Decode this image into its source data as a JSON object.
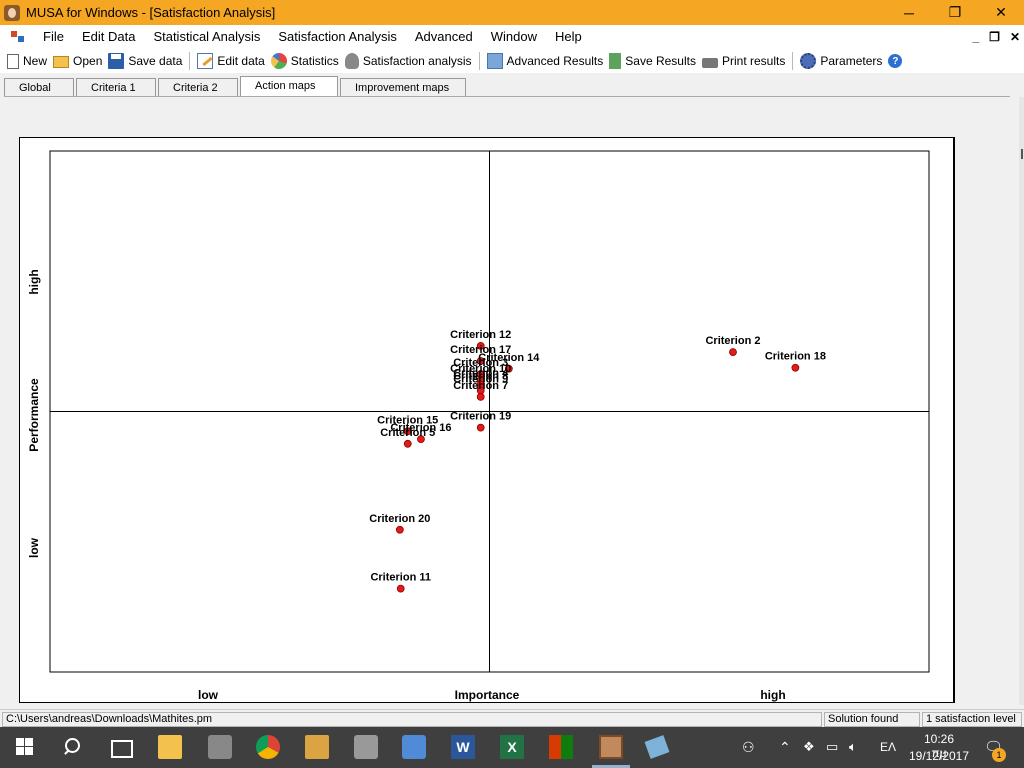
{
  "window": {
    "title": "MUSA for Windows - [Satisfaction Analysis]",
    "controls": {
      "minimize": "─",
      "restore": "❐",
      "close": "✕"
    }
  },
  "menu": {
    "items": [
      "File",
      "Edit Data",
      "Statistical Analysis",
      "Satisfaction Analysis",
      "Advanced",
      "Window",
      "Help"
    ],
    "mdi": {
      "minimize": "_",
      "restore": "❐",
      "close": "✕"
    }
  },
  "toolbar": {
    "new": "New",
    "open": "Open",
    "save_data": "Save data",
    "edit_data": "Edit data",
    "statistics": "Statistics",
    "satisfaction_analysis": "Satisfaction analysis",
    "advanced_results": "Advanced Results",
    "save_results": "Save Results",
    "print_results": "Print results",
    "parameters": "Parameters",
    "help": "?"
  },
  "tabs": [
    "Global",
    "Criteria 1",
    "Criteria 2",
    "Action maps",
    "Improvement maps"
  ],
  "active_tab": "Action maps",
  "chart_data": {
    "type": "scatter",
    "xlabel": "Importance",
    "ylabel": "Performance",
    "x_low_label": "low",
    "x_high_label": "high",
    "y_low_label": "low",
    "y_high_label": "high",
    "xlim": [
      0,
      100
    ],
    "ylim": [
      0,
      100
    ],
    "x_divider": 50,
    "y_divider": 50,
    "point_color": "#e31a1a",
    "points": [
      {
        "label": "Criterion 12",
        "x": 49.0,
        "y": 62.6
      },
      {
        "label": "Criterion 17",
        "x": 49.0,
        "y": 59.7
      },
      {
        "label": "Criterion 14",
        "x": 52.2,
        "y": 58.2
      },
      {
        "label": "Criterion 3",
        "x": 49.0,
        "y": 57.2
      },
      {
        "label": "Criterion 10",
        "x": 49.0,
        "y": 56.0
      },
      {
        "label": "Criterion 4",
        "x": 49.0,
        "y": 55.2
      },
      {
        "label": "Criterion 8",
        "x": 49.0,
        "y": 54.6
      },
      {
        "label": "Criterion 9",
        "x": 49.0,
        "y": 54.0
      },
      {
        "label": "Criterion 7",
        "x": 49.0,
        "y": 52.8
      },
      {
        "label": "Criterion 2",
        "x": 77.7,
        "y": 61.4
      },
      {
        "label": "Criterion 18",
        "x": 84.8,
        "y": 58.4
      },
      {
        "label": "Criterion 19",
        "x": 49.0,
        "y": 46.9
      },
      {
        "label": "Criterion 15",
        "x": 40.7,
        "y": 46.2
      },
      {
        "label": "Criterion 16",
        "x": 42.2,
        "y": 44.7
      },
      {
        "label": "Criterion 5",
        "x": 40.7,
        "y": 43.8
      },
      {
        "label": "Criterion 20",
        "x": 39.8,
        "y": 27.3
      },
      {
        "label": "Criterion 11",
        "x": 39.9,
        "y": 16.0
      }
    ]
  },
  "status": {
    "path": "C:\\Users\\andreas\\Downloads\\Mathites.pm",
    "solution": "Solution found",
    "level": "1 satisfaction level"
  },
  "taskbar": {
    "tray": {
      "language": "ΕΛ",
      "time": "10:26 πμ",
      "date": "19/12/2017",
      "notifications": "1"
    }
  }
}
